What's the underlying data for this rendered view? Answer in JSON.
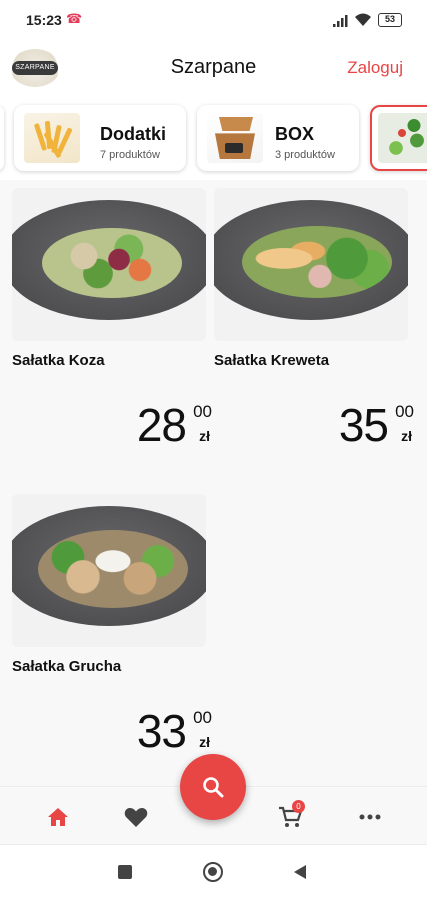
{
  "status_bar": {
    "time": "15:23",
    "notification": "☎",
    "battery": "53"
  },
  "header": {
    "title": "Szarpane",
    "login_label": "Zaloguj",
    "logo_text": "SZARPANE"
  },
  "categories": [
    {
      "name": "Dodatki",
      "count": "7 produktów"
    },
    {
      "name": "BOX",
      "count": "3 produktów"
    }
  ],
  "products": [
    {
      "name": "Sałatka Koza",
      "price_int": "28",
      "price_cents": "00",
      "currency": "zł"
    },
    {
      "name": "Sałatka Kreweta",
      "price_int": "35",
      "price_cents": "00",
      "currency": "zł"
    },
    {
      "name": "Sałatka Grucha",
      "price_int": "33",
      "price_cents": "00",
      "currency": "zł"
    }
  ],
  "bottom_nav": {
    "home": "home-icon",
    "favorites": "heart-icon",
    "search": "search-icon",
    "cart": "cart-icon",
    "cart_count": "0",
    "more": "more-icon"
  },
  "colors": {
    "accent": "#e84545",
    "text": "#111111",
    "background": "#f8f8f9"
  }
}
